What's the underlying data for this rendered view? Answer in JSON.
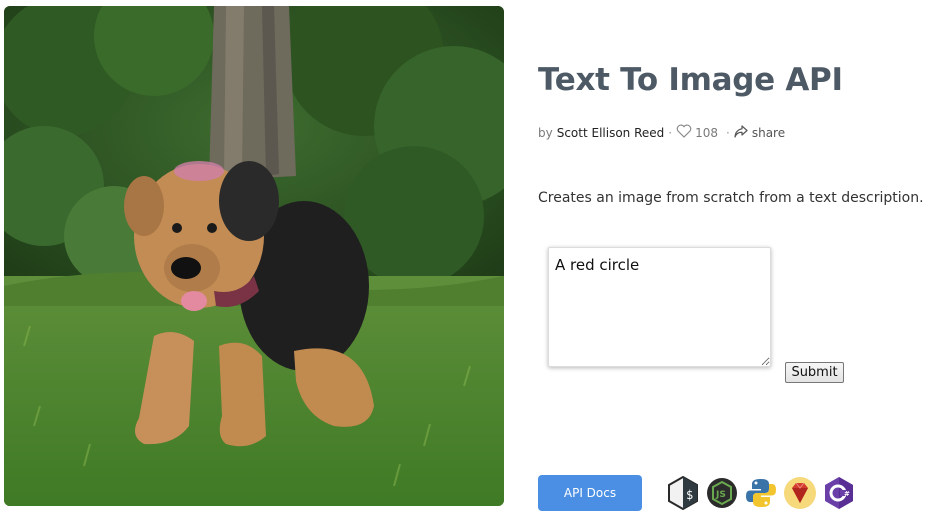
{
  "header": {
    "title": "Text To Image API"
  },
  "meta": {
    "by_label": "by",
    "author": "Scott Ellison Reed",
    "likes": "108",
    "share_label": "share"
  },
  "description": "Creates an image from scratch from a text description.",
  "form": {
    "prompt_value": "A red circle",
    "submit_label": "Submit"
  },
  "footer": {
    "api_docs_label": "API Docs",
    "language_icons": [
      "bash-icon",
      "nodejs-icon",
      "python-icon",
      "ruby-icon",
      "csharp-icon"
    ]
  },
  "colors": {
    "title": "#4d5a66",
    "api_button": "#4a8fe3"
  }
}
